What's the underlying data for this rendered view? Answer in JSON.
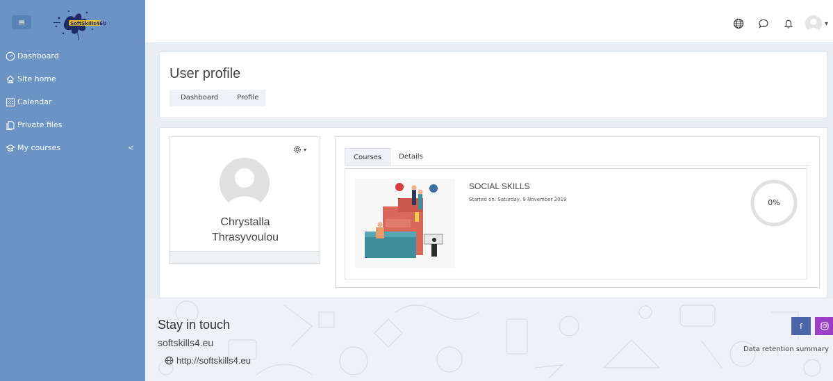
{
  "header": {
    "menu_icon": "hamburger-icon",
    "logo_text": "SoftSkills4EU",
    "icons": [
      "globe-icon",
      "chat-bubble-icon",
      "bell-icon",
      "user-avatar"
    ]
  },
  "sidebar": {
    "items": [
      {
        "label": "Dashboard",
        "icon": "gauge-icon"
      },
      {
        "label": "Site home",
        "icon": "home-icon"
      },
      {
        "label": "Calendar",
        "icon": "calendar-icon"
      },
      {
        "label": "Private files",
        "icon": "files-icon"
      },
      {
        "label": "My courses",
        "icon": "graduation-cap-icon",
        "chevron": "<"
      }
    ]
  },
  "page": {
    "title": "User profile",
    "breadcrumb": [
      "Dashboard",
      "Profile"
    ]
  },
  "profile": {
    "name_line1": "Chrystalla",
    "name_line2": "Thrasyvoulou",
    "settings_icon": "gear-icon"
  },
  "tabs": [
    "Courses",
    "Details"
  ],
  "course": {
    "name": "SOCIAL SKILLS",
    "started": "Started on: Saturday, 9 November 2019",
    "progress_label": "0%",
    "progress_value": 0
  },
  "footer": {
    "stay_in_touch": "Stay in touch",
    "site_name": "softskills4.eu",
    "url": "http://softskills4.eu",
    "retention": "Data retention summary",
    "social": [
      "facebook-icon",
      "instagram-icon"
    ]
  },
  "colors": {
    "sidebar": "#6b94c5",
    "progress_track": "#e0e0e0",
    "facebook": "#4a66a8",
    "instagram": "#9d3fc5"
  }
}
